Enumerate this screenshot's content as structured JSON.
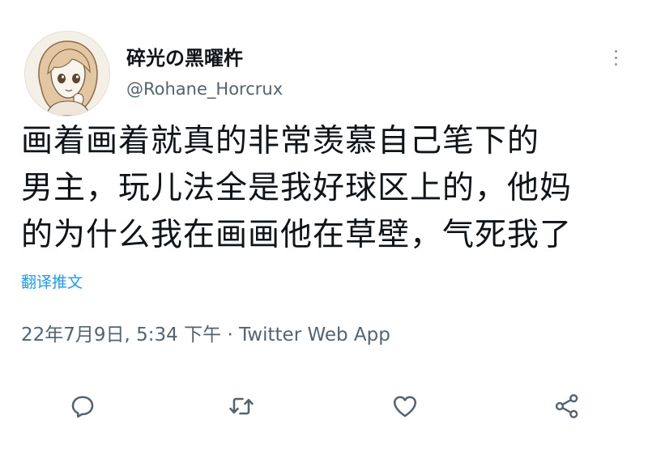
{
  "user": {
    "display_name": "碎光の黑曜杵",
    "handle": "@Rohane_Horcrux"
  },
  "tweet": {
    "lines": [
      "画着画着就真的非常羡慕自己笔下的",
      "男主，玩儿法全是我好球区上的，他妈",
      "的为什么我在画画他在草壁，气死我了"
    ],
    "translate_label": "翻译推文",
    "timestamp": "22年7月9日, 5:34 下午",
    "separator": "·",
    "source_app": "Twitter Web App"
  },
  "icons": {
    "more": "more-options-icon",
    "reply": "reply-icon",
    "retweet": "retweet-icon",
    "like": "like-icon",
    "share": "share-icon"
  },
  "colors": {
    "text": "#0f1419",
    "secondary": "#536471",
    "accent": "#1d9bf0",
    "icon": "#536471"
  }
}
